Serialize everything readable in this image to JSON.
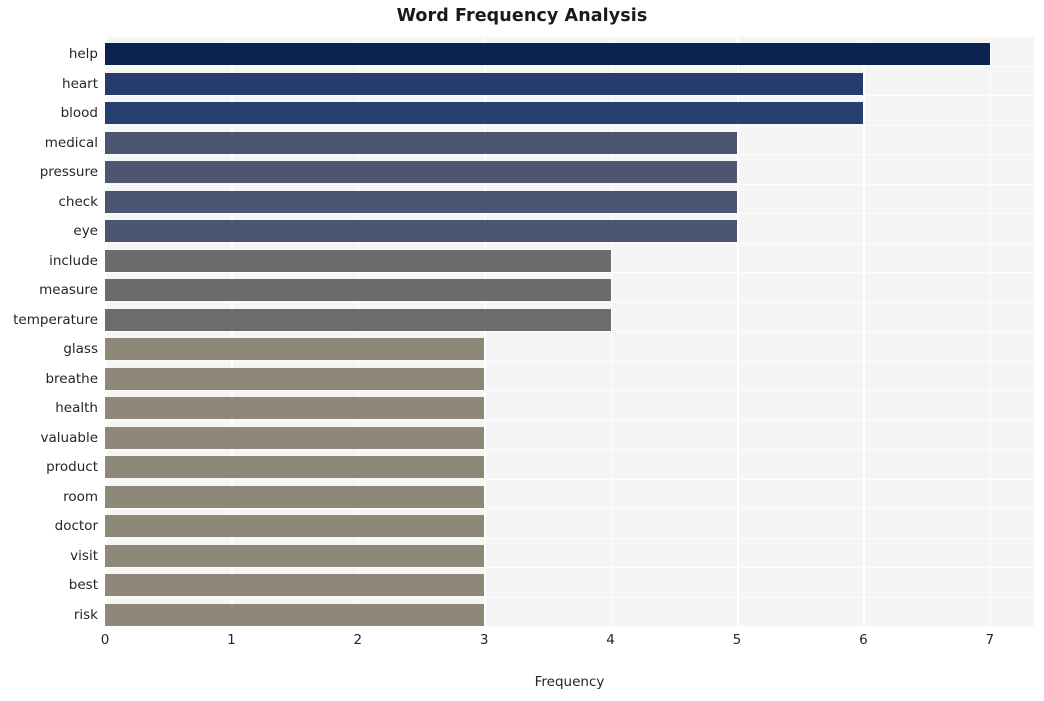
{
  "chart_data": {
    "type": "bar",
    "orientation": "horizontal",
    "title": "Word Frequency Analysis",
    "xlabel": "Frequency",
    "ylabel": "",
    "xlim": [
      0,
      7.35
    ],
    "xticks": [
      0,
      1,
      2,
      3,
      4,
      5,
      6,
      7
    ],
    "xtick_labels": [
      "0",
      "1",
      "2",
      "3",
      "4",
      "5",
      "6",
      "7"
    ],
    "grid": true,
    "legend": null,
    "categories": [
      "help",
      "heart",
      "blood",
      "medical",
      "pressure",
      "check",
      "eye",
      "include",
      "measure",
      "temperature",
      "glass",
      "breathe",
      "health",
      "valuable",
      "product",
      "room",
      "doctor",
      "visit",
      "best",
      "risk"
    ],
    "values": [
      7,
      6,
      6,
      5,
      5,
      5,
      5,
      4,
      4,
      4,
      3,
      3,
      3,
      3,
      3,
      3,
      3,
      3,
      3,
      3
    ],
    "bar_colors": [
      "#0a2351",
      "#263c6e",
      "#27406f",
      "#4c5570",
      "#4d5671",
      "#4c5570",
      "#4d5671",
      "#6b6b6e",
      "#6b6b6e",
      "#6c6c6f",
      "#8e8878",
      "#8e8878",
      "#8e8878",
      "#8e8878",
      "#8e8878",
      "#8e8878",
      "#8e8878",
      "#8e8878",
      "#8e8878",
      "#8e8878"
    ]
  },
  "style": {
    "figure_background": "#ffffff",
    "plot_background": "#f5f5f6",
    "gridline_color": "#ffffff",
    "tick_label_color": "#262626",
    "title_color": "#1a1a1a"
  }
}
